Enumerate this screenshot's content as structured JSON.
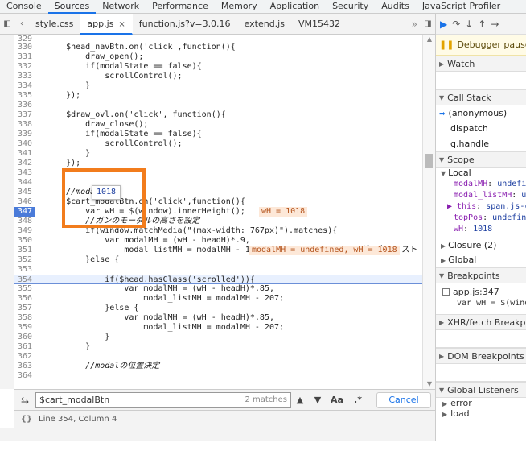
{
  "top_tabs": [
    "Console",
    "Sources",
    "Network",
    "Performance",
    "Memory",
    "Application",
    "Security",
    "Audits",
    "JavaScript Profiler"
  ],
  "active_top_tab": "Sources",
  "file_tabs": [
    "style.css",
    "app.js",
    "function.js?v=3.0.16",
    "extend.js",
    "VM15432"
  ],
  "editor": {
    "lines": [
      {
        "n": "329",
        "code": ""
      },
      {
        "n": "330",
        "code": "    $head_navBtn.on('click',function(){"
      },
      {
        "n": "331",
        "code": "        draw_open();"
      },
      {
        "n": "332",
        "code": "        if(modalState == false){"
      },
      {
        "n": "333",
        "code": "            scrollControl();"
      },
      {
        "n": "334",
        "code": "        }"
      },
      {
        "n": "335",
        "code": "    });"
      },
      {
        "n": "336",
        "code": ""
      },
      {
        "n": "337",
        "code": "    $draw_ovl.on('click', function(){"
      },
      {
        "n": "338",
        "code": "        draw_close();"
      },
      {
        "n": "339",
        "code": "        if(modalState == false){"
      },
      {
        "n": "340",
        "code": "            scrollControl();"
      },
      {
        "n": "341",
        "code": "        }"
      },
      {
        "n": "342",
        "code": "    });"
      },
      {
        "n": "343",
        "code": ""
      },
      {
        "n": "344",
        "code": ""
      },
      {
        "n": "345",
        "code": "    //modal"
      },
      {
        "n": "346",
        "code": "    $cart_modalBtn.on('click',function(){"
      },
      {
        "n": "347",
        "code": "        var wH = $(window).innerHeight();"
      },
      {
        "n": "348",
        "code": "        //ガンのモーダルの高さを設定"
      },
      {
        "n": "349",
        "code": "        if(window.matchMedia(\"(max-width: 767px)\").matches){"
      },
      {
        "n": "350",
        "code": "            var modalMH = (wH - headH)*.9,"
      },
      {
        "n": "351",
        "code": "                modal_listMH = modalMH - 178; //modal_listMHはモーダル内のリスト"
      },
      {
        "n": "352",
        "code": "        }else {"
      },
      {
        "n": "353",
        "code": ""
      },
      {
        "n": "354",
        "code": "            if($head.hasClass('scrolled')){"
      },
      {
        "n": "355",
        "code": "                var modalMH = (wH - headH)*.85,"
      },
      {
        "n": "356",
        "code": "                    modal_listMH = modalMH - 207;"
      },
      {
        "n": "357",
        "code": "            }else {"
      },
      {
        "n": "358",
        "code": "                var modalMH = (wH - headH)*.85,"
      },
      {
        "n": "359",
        "code": "                    modal_listMH = modalMH - 207;"
      },
      {
        "n": "360",
        "code": "            }"
      },
      {
        "n": "361",
        "code": "        }"
      },
      {
        "n": "362",
        "code": ""
      },
      {
        "n": "363",
        "code": "        //modalの位置決定"
      },
      {
        "n": "364",
        "code": ""
      }
    ],
    "inline_value_347": "wH = 1018",
    "inline_value_350": "modalMH = undefined, wH = 1018",
    "hover_value": "1018"
  },
  "search": {
    "value": "$cart_modalBtn",
    "matches": "2 matches",
    "aa": "Aa",
    "regex": ".*",
    "cancel": "Cancel"
  },
  "status": {
    "position": "Line 354, Column 4"
  },
  "debugger": {
    "paused": "Debugger paused",
    "watch": "Watch",
    "call_stack": "Call Stack",
    "frames": [
      "(anonymous)",
      "dispatch",
      "q.handle"
    ],
    "scope": "Scope",
    "local": "Local",
    "scope_vars": [
      {
        "k": "modalMH",
        "v": "undefi"
      },
      {
        "k": "modal_listMH",
        "v": "u"
      },
      {
        "k": "▶ this",
        "v": "span.js-c"
      },
      {
        "k": "topPos",
        "v": "undefin"
      },
      {
        "k": "wH",
        "v": "1018"
      }
    ],
    "closure": "Closure (2)",
    "global": "Global",
    "breakpoints": "Breakpoints",
    "bp_file": "app.js:347",
    "bp_code": "var wH = $(windo",
    "xhr": "XHR/fetch Breakpoin",
    "dom": "DOM Breakpoints",
    "global_listeners": "Global Listeners",
    "listeners": [
      "error",
      "load"
    ]
  }
}
